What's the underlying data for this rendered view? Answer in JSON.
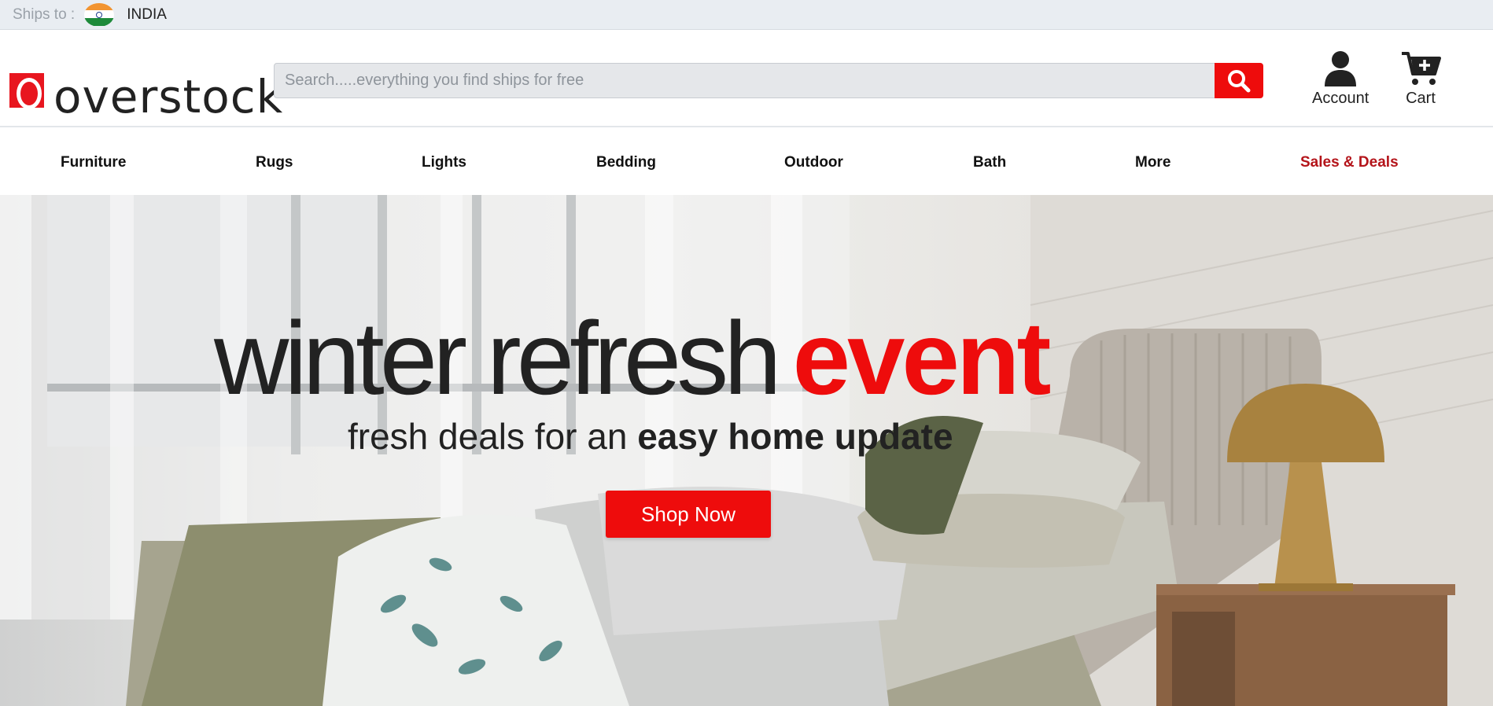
{
  "shipbar": {
    "label": "Ships to :",
    "country": "INDIA",
    "flag_icon": "india-flag-icon"
  },
  "header": {
    "logo_text": "overstock",
    "search_placeholder": "Search.....everything you find ships for free",
    "search_icon": "search-icon",
    "account_label": "Account",
    "cart_label": "Cart",
    "accent_color": "#ee0c0c"
  },
  "nav": {
    "items": [
      {
        "label": "Furniture"
      },
      {
        "label": "Rugs"
      },
      {
        "label": "Lights"
      },
      {
        "label": "Bedding"
      },
      {
        "label": "Outdoor"
      },
      {
        "label": "Bath"
      },
      {
        "label": "More"
      },
      {
        "label": "Sales & Deals"
      }
    ],
    "deals_color": "#b4141a"
  },
  "hero": {
    "title_part1": "winter refresh",
    "title_part2": "event",
    "subtitle_part1": "fresh deals for an",
    "subtitle_part2": "easy home update",
    "cta_label": "Shop Now"
  }
}
